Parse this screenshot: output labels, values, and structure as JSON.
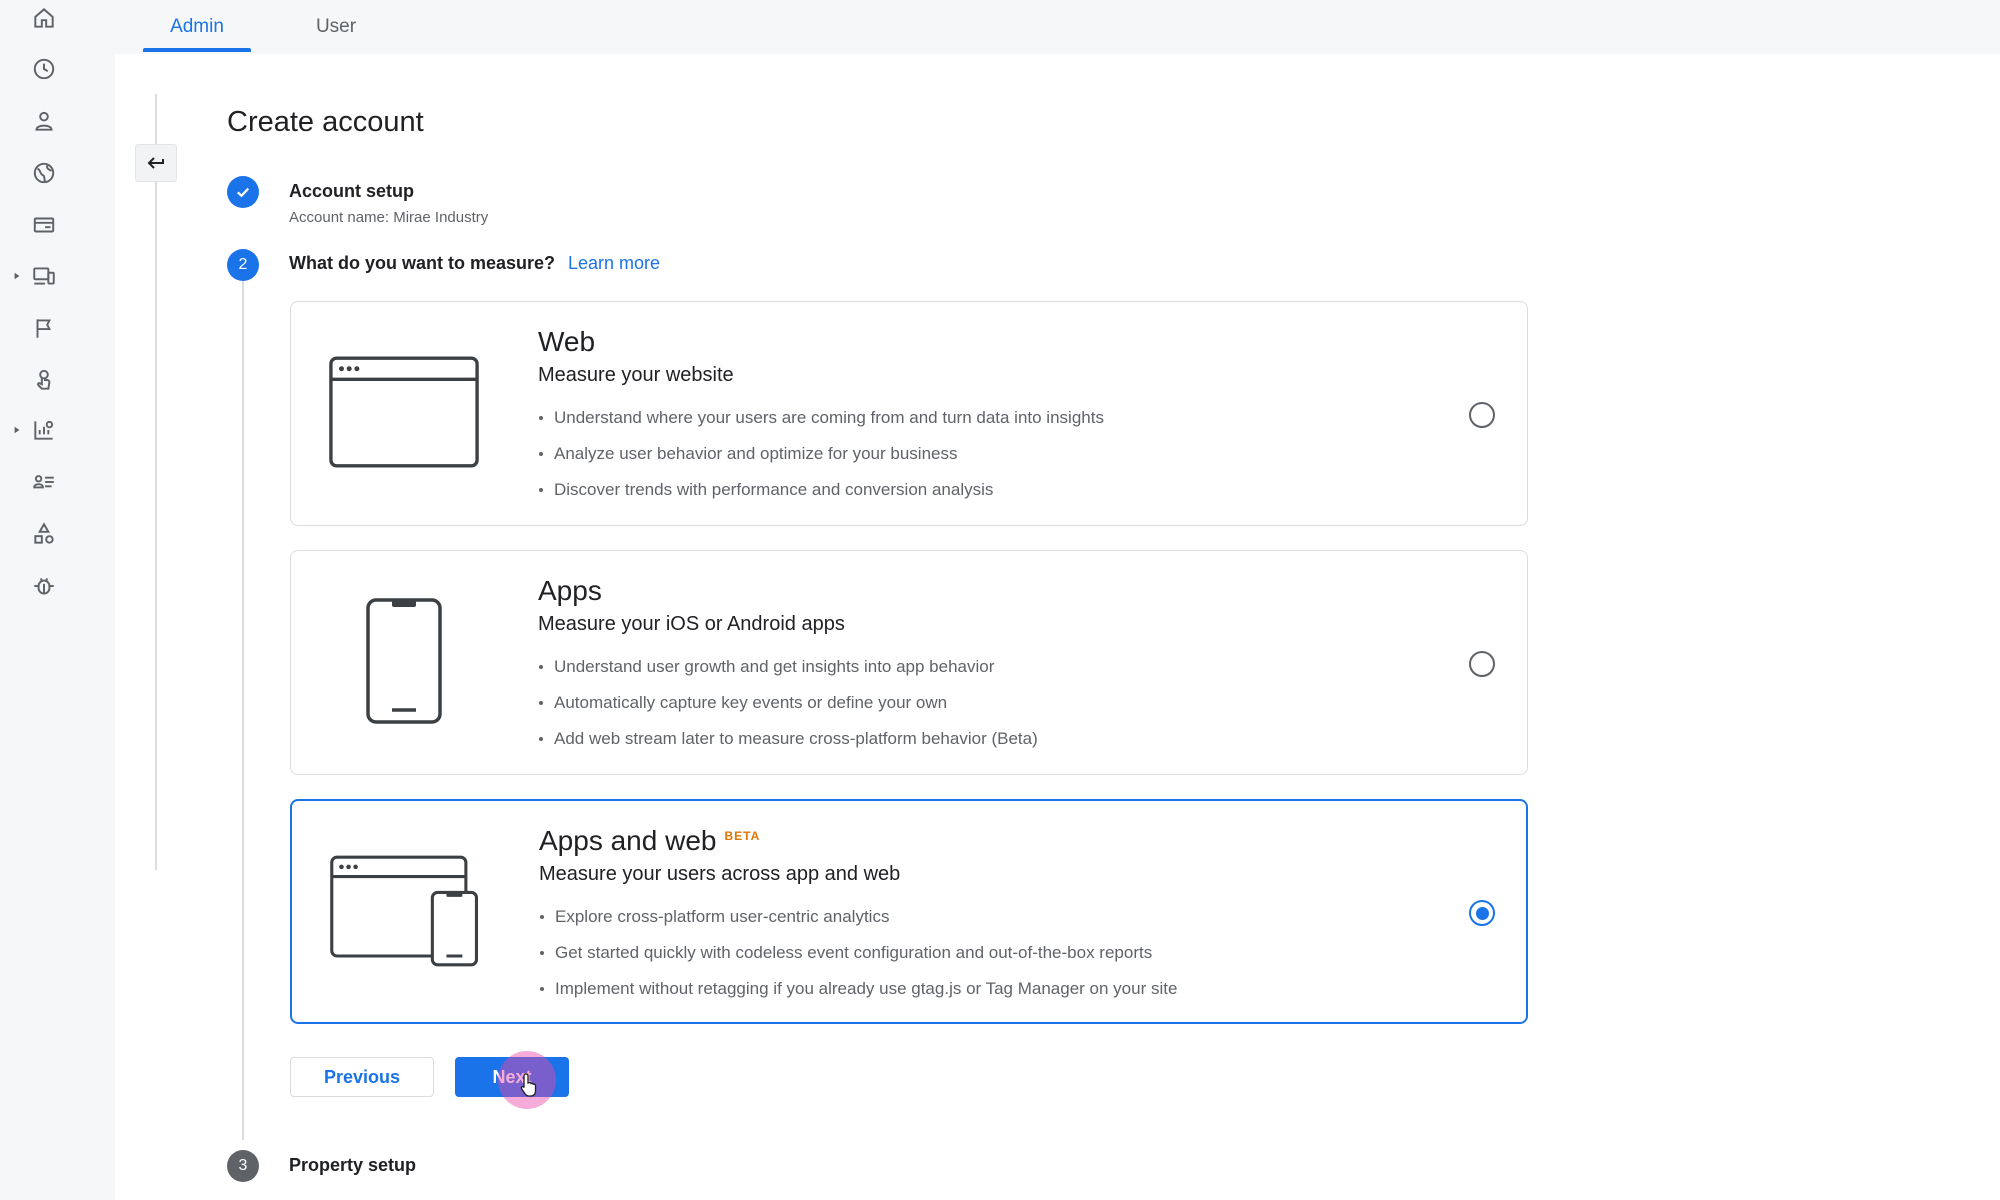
{
  "colors": {
    "accent": "#1a73e8",
    "beta": "#e37400",
    "rail_bg": "#f6f7f8",
    "muted_text": "#5f6368"
  },
  "nav_rail": [
    {
      "icon": "home-icon"
    },
    {
      "icon": "clock-icon"
    },
    {
      "icon": "person-icon"
    },
    {
      "icon": "globe-icon"
    },
    {
      "icon": "card-icon"
    },
    {
      "icon": "devices-icon",
      "expandable": true
    },
    {
      "icon": "flag-icon"
    },
    {
      "icon": "touch-icon"
    },
    {
      "icon": "report-icon",
      "expandable": true
    },
    {
      "icon": "audience-list-icon"
    },
    {
      "icon": "shapes-icon"
    },
    {
      "icon": "bug-icon"
    }
  ],
  "tabs": [
    {
      "label": "Admin",
      "active": true
    },
    {
      "label": "User",
      "active": false
    }
  ],
  "page": {
    "title": "Create account"
  },
  "steps": [
    {
      "number": "",
      "status": "complete",
      "label": "Account setup",
      "sub": "Account name: Mirae Industry"
    },
    {
      "number": "2",
      "status": "active",
      "label": "What do you want to measure?",
      "link": "Learn more"
    },
    {
      "number": "3",
      "status": "pending",
      "label": "Property setup"
    }
  ],
  "options": [
    {
      "title": "Web",
      "subtitle": "Measure your website",
      "bullets": [
        "Understand where your users are coming from and turn data into insights",
        "Analyze user behavior and optimize for your business",
        "Discover trends with performance and conversion analysis"
      ],
      "selected": false
    },
    {
      "title": "Apps",
      "subtitle": "Measure your iOS or Android apps",
      "bullets": [
        "Understand user growth and get insights into app behavior",
        "Automatically capture key events or define your own",
        "Add web stream later to measure cross-platform behavior (Beta)"
      ],
      "selected": false
    },
    {
      "title": "Apps and web",
      "badge": "BETA",
      "subtitle": "Measure your users across app and web",
      "bullets": [
        "Explore cross-platform user-centric analytics",
        "Get started quickly with codeless event configuration and out-of-the-box reports",
        "Implement without retagging if you already use gtag.js or Tag Manager on your site"
      ],
      "selected": true
    }
  ],
  "actions": {
    "previous_label": "Previous",
    "next_label": "Next"
  }
}
